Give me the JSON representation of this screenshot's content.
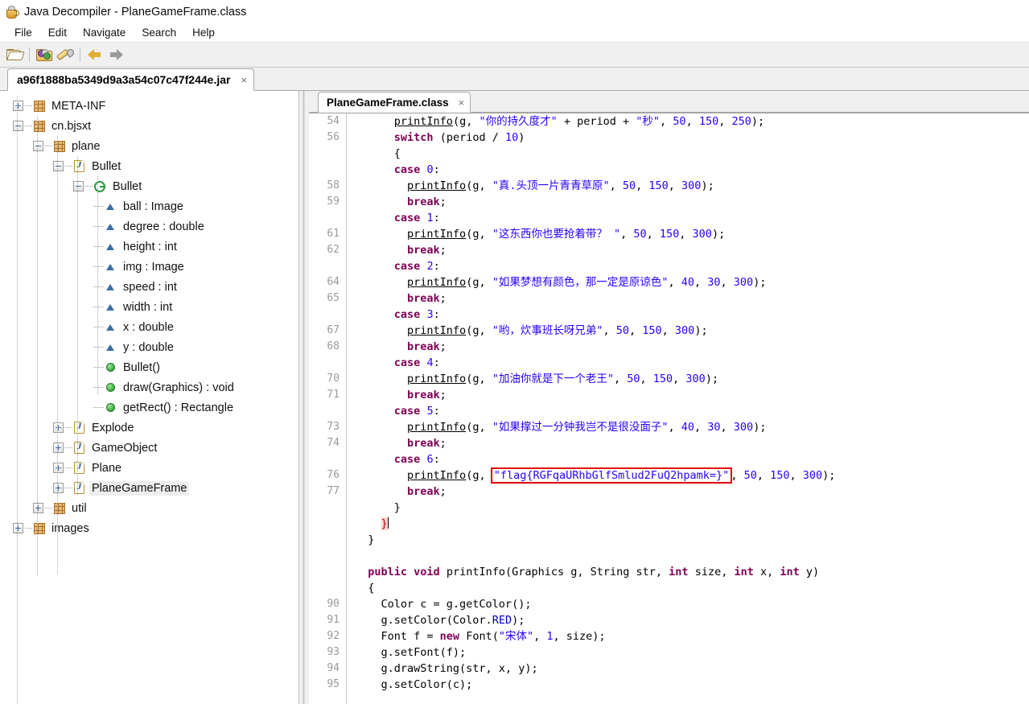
{
  "window": {
    "title": "Java Decompiler - PlaneGameFrame.class",
    "app_icon": "java-coffee-cup-icon"
  },
  "menubar": {
    "items": [
      {
        "label": "File"
      },
      {
        "label": "Edit"
      },
      {
        "label": "Navigate"
      },
      {
        "label": "Search"
      },
      {
        "label": "Help"
      }
    ]
  },
  "toolbar": {
    "buttons": [
      {
        "name": "open-file-button",
        "icon": "folder-open-icon"
      },
      {
        "name": "open-jar-button",
        "icon": "jar-folder-icon"
      },
      {
        "name": "decompile-tool-button",
        "icon": "wand-icon"
      },
      {
        "name": "navigate-back-button",
        "icon": "arrow-left-icon"
      },
      {
        "name": "navigate-forward-button",
        "icon": "arrow-right-icon"
      }
    ]
  },
  "jar_tabs": [
    {
      "label": "a96f1888ba5349d9a3a54c07c47f244e.jar",
      "close": "×",
      "active": true
    }
  ],
  "tree": {
    "nodes": [
      {
        "label": "META-INF",
        "depth": 0,
        "icon": "package-icon",
        "expander": "plus",
        "selected": false
      },
      {
        "label": "cn.bjsxt",
        "depth": 0,
        "icon": "package-icon",
        "expander": "minus",
        "selected": false
      },
      {
        "label": "plane",
        "depth": 1,
        "icon": "package-icon",
        "expander": "minus",
        "selected": false
      },
      {
        "label": "Bullet",
        "depth": 2,
        "icon": "java-file-icon",
        "expander": "minus",
        "selected": false
      },
      {
        "label": "Bullet",
        "depth": 3,
        "icon": "class-icon",
        "expander": "minus",
        "selected": false
      },
      {
        "label": "ball : Image",
        "depth": 4,
        "icon": "field-icon",
        "expander": "none",
        "selected": false
      },
      {
        "label": "degree : double",
        "depth": 4,
        "icon": "field-icon",
        "expander": "none",
        "selected": false
      },
      {
        "label": "height : int",
        "depth": 4,
        "icon": "field-icon",
        "expander": "none",
        "selected": false
      },
      {
        "label": "img : Image",
        "depth": 4,
        "icon": "field-icon",
        "expander": "none",
        "selected": false
      },
      {
        "label": "speed : int",
        "depth": 4,
        "icon": "field-icon",
        "expander": "none",
        "selected": false
      },
      {
        "label": "width : int",
        "depth": 4,
        "icon": "field-icon",
        "expander": "none",
        "selected": false
      },
      {
        "label": "x : double",
        "depth": 4,
        "icon": "field-icon",
        "expander": "none",
        "selected": false
      },
      {
        "label": "y : double",
        "depth": 4,
        "icon": "field-icon",
        "expander": "none",
        "selected": false
      },
      {
        "label": "Bullet()",
        "depth": 4,
        "icon": "method-icon",
        "expander": "none",
        "selected": false
      },
      {
        "label": "draw(Graphics) : void",
        "depth": 4,
        "icon": "method-icon",
        "expander": "none",
        "selected": false
      },
      {
        "label": "getRect() : Rectangle",
        "depth": 4,
        "icon": "method-icon",
        "expander": "none",
        "selected": false
      },
      {
        "label": "Explode",
        "depth": 2,
        "icon": "java-file-icon",
        "expander": "plus",
        "selected": false
      },
      {
        "label": "GameObject",
        "depth": 2,
        "icon": "java-file-icon",
        "expander": "plus",
        "selected": false
      },
      {
        "label": "Plane",
        "depth": 2,
        "icon": "java-file-icon",
        "expander": "plus",
        "selected": false
      },
      {
        "label": "PlaneGameFrame",
        "depth": 2,
        "icon": "java-file-icon",
        "expander": "plus",
        "selected": true
      },
      {
        "label": "util",
        "depth": 1,
        "icon": "package-icon",
        "expander": "plus",
        "selected": false
      },
      {
        "label": "images",
        "depth": 0,
        "icon": "package-icon",
        "expander": "plus",
        "selected": false
      }
    ]
  },
  "editor": {
    "tabs": [
      {
        "label": "PlaneGameFrame.class",
        "close": "×",
        "active": true
      }
    ],
    "gutter": [
      "54",
      "56",
      "",
      "",
      "58",
      "59",
      "",
      "61",
      "62",
      "",
      "64",
      "65",
      "",
      "67",
      "68",
      "",
      "70",
      "71",
      "",
      "73",
      "74",
      "",
      "76",
      "77",
      "",
      "",
      "",
      "",
      "",
      "",
      "90",
      "91",
      "92",
      "93",
      "94",
      "95"
    ],
    "highlight_box_color": "#e00000",
    "flag_string": "\"flag{RGFqaURhbGlfSmlud2FuQ2hpamk=}\"",
    "lines": [
      [
        {
          "t": "      ",
          "c": "plain"
        },
        {
          "t": "printInfo",
          "c": "mth"
        },
        {
          "t": "(g, ",
          "c": "plain"
        },
        {
          "t": "\"你的持久度才\"",
          "c": "str"
        },
        {
          "t": " + period + ",
          "c": "plain"
        },
        {
          "t": "\"秒\"",
          "c": "str"
        },
        {
          "t": ", ",
          "c": "plain"
        },
        {
          "t": "50",
          "c": "num"
        },
        {
          "t": ", ",
          "c": "plain"
        },
        {
          "t": "150",
          "c": "num"
        },
        {
          "t": ", ",
          "c": "plain"
        },
        {
          "t": "250",
          "c": "num"
        },
        {
          "t": ");",
          "c": "plain"
        }
      ],
      [
        {
          "t": "      ",
          "c": "plain"
        },
        {
          "t": "switch",
          "c": "kw"
        },
        {
          "t": " (period / ",
          "c": "plain"
        },
        {
          "t": "10",
          "c": "num"
        },
        {
          "t": ")",
          "c": "plain"
        }
      ],
      [
        {
          "t": "      {",
          "c": "plain"
        }
      ],
      [
        {
          "t": "      ",
          "c": "plain"
        },
        {
          "t": "case",
          "c": "kw"
        },
        {
          "t": " ",
          "c": "plain"
        },
        {
          "t": "0",
          "c": "num"
        },
        {
          "t": ":",
          "c": "plain"
        }
      ],
      [
        {
          "t": "        ",
          "c": "plain"
        },
        {
          "t": "printInfo",
          "c": "mth"
        },
        {
          "t": "(g, ",
          "c": "plain"
        },
        {
          "t": "\"真.头顶一片青青草原\"",
          "c": "str"
        },
        {
          "t": ", ",
          "c": "plain"
        },
        {
          "t": "50",
          "c": "num"
        },
        {
          "t": ", ",
          "c": "plain"
        },
        {
          "t": "150",
          "c": "num"
        },
        {
          "t": ", ",
          "c": "plain"
        },
        {
          "t": "300",
          "c": "num"
        },
        {
          "t": ");",
          "c": "plain"
        }
      ],
      [
        {
          "t": "        ",
          "c": "plain"
        },
        {
          "t": "break",
          "c": "kw"
        },
        {
          "t": ";",
          "c": "plain"
        }
      ],
      [
        {
          "t": "      ",
          "c": "plain"
        },
        {
          "t": "case",
          "c": "kw"
        },
        {
          "t": " ",
          "c": "plain"
        },
        {
          "t": "1",
          "c": "num"
        },
        {
          "t": ":",
          "c": "plain"
        }
      ],
      [
        {
          "t": "        ",
          "c": "plain"
        },
        {
          "t": "printInfo",
          "c": "mth"
        },
        {
          "t": "(g, ",
          "c": "plain"
        },
        {
          "t": "\"这东西你也要抢着带？ \"",
          "c": "str"
        },
        {
          "t": ", ",
          "c": "plain"
        },
        {
          "t": "50",
          "c": "num"
        },
        {
          "t": ", ",
          "c": "plain"
        },
        {
          "t": "150",
          "c": "num"
        },
        {
          "t": ", ",
          "c": "plain"
        },
        {
          "t": "300",
          "c": "num"
        },
        {
          "t": ");",
          "c": "plain"
        }
      ],
      [
        {
          "t": "        ",
          "c": "plain"
        },
        {
          "t": "break",
          "c": "kw"
        },
        {
          "t": ";",
          "c": "plain"
        }
      ],
      [
        {
          "t": "      ",
          "c": "plain"
        },
        {
          "t": "case",
          "c": "kw"
        },
        {
          "t": " ",
          "c": "plain"
        },
        {
          "t": "2",
          "c": "num"
        },
        {
          "t": ":",
          "c": "plain"
        }
      ],
      [
        {
          "t": "        ",
          "c": "plain"
        },
        {
          "t": "printInfo",
          "c": "mth"
        },
        {
          "t": "(g, ",
          "c": "plain"
        },
        {
          "t": "\"如果梦想有颜色，那一定是原谅色\"",
          "c": "str"
        },
        {
          "t": ", ",
          "c": "plain"
        },
        {
          "t": "40",
          "c": "num"
        },
        {
          "t": ", ",
          "c": "plain"
        },
        {
          "t": "30",
          "c": "num"
        },
        {
          "t": ", ",
          "c": "plain"
        },
        {
          "t": "300",
          "c": "num"
        },
        {
          "t": ");",
          "c": "plain"
        }
      ],
      [
        {
          "t": "        ",
          "c": "plain"
        },
        {
          "t": "break",
          "c": "kw"
        },
        {
          "t": ";",
          "c": "plain"
        }
      ],
      [
        {
          "t": "      ",
          "c": "plain"
        },
        {
          "t": "case",
          "c": "kw"
        },
        {
          "t": " ",
          "c": "plain"
        },
        {
          "t": "3",
          "c": "num"
        },
        {
          "t": ":",
          "c": "plain"
        }
      ],
      [
        {
          "t": "        ",
          "c": "plain"
        },
        {
          "t": "printInfo",
          "c": "mth"
        },
        {
          "t": "(g, ",
          "c": "plain"
        },
        {
          "t": "\"哟，炊事班长呀兄弟\"",
          "c": "str"
        },
        {
          "t": ", ",
          "c": "plain"
        },
        {
          "t": "50",
          "c": "num"
        },
        {
          "t": ", ",
          "c": "plain"
        },
        {
          "t": "150",
          "c": "num"
        },
        {
          "t": ", ",
          "c": "plain"
        },
        {
          "t": "300",
          "c": "num"
        },
        {
          "t": ");",
          "c": "plain"
        }
      ],
      [
        {
          "t": "        ",
          "c": "plain"
        },
        {
          "t": "break",
          "c": "kw"
        },
        {
          "t": ";",
          "c": "plain"
        }
      ],
      [
        {
          "t": "      ",
          "c": "plain"
        },
        {
          "t": "case",
          "c": "kw"
        },
        {
          "t": " ",
          "c": "plain"
        },
        {
          "t": "4",
          "c": "num"
        },
        {
          "t": ":",
          "c": "plain"
        }
      ],
      [
        {
          "t": "        ",
          "c": "plain"
        },
        {
          "t": "printInfo",
          "c": "mth"
        },
        {
          "t": "(g, ",
          "c": "plain"
        },
        {
          "t": "\"加油你就是下一个老王\"",
          "c": "str"
        },
        {
          "t": ", ",
          "c": "plain"
        },
        {
          "t": "50",
          "c": "num"
        },
        {
          "t": ", ",
          "c": "plain"
        },
        {
          "t": "150",
          "c": "num"
        },
        {
          "t": ", ",
          "c": "plain"
        },
        {
          "t": "300",
          "c": "num"
        },
        {
          "t": ");",
          "c": "plain"
        }
      ],
      [
        {
          "t": "        ",
          "c": "plain"
        },
        {
          "t": "break",
          "c": "kw"
        },
        {
          "t": ";",
          "c": "plain"
        }
      ],
      [
        {
          "t": "      ",
          "c": "plain"
        },
        {
          "t": "case",
          "c": "kw"
        },
        {
          "t": " ",
          "c": "plain"
        },
        {
          "t": "5",
          "c": "num"
        },
        {
          "t": ":",
          "c": "plain"
        }
      ],
      [
        {
          "t": "        ",
          "c": "plain"
        },
        {
          "t": "printInfo",
          "c": "mth"
        },
        {
          "t": "(g, ",
          "c": "plain"
        },
        {
          "t": "\"如果撑过一分钟我岂不是很没面子\"",
          "c": "str"
        },
        {
          "t": ", ",
          "c": "plain"
        },
        {
          "t": "40",
          "c": "num"
        },
        {
          "t": ", ",
          "c": "plain"
        },
        {
          "t": "30",
          "c": "num"
        },
        {
          "t": ", ",
          "c": "plain"
        },
        {
          "t": "300",
          "c": "num"
        },
        {
          "t": ");",
          "c": "plain"
        }
      ],
      [
        {
          "t": "        ",
          "c": "plain"
        },
        {
          "t": "break",
          "c": "kw"
        },
        {
          "t": ";",
          "c": "plain"
        }
      ],
      [
        {
          "t": "      ",
          "c": "plain"
        },
        {
          "t": "case",
          "c": "kw"
        },
        {
          "t": " ",
          "c": "plain"
        },
        {
          "t": "6",
          "c": "num"
        },
        {
          "t": ":",
          "c": "plain"
        }
      ],
      [
        {
          "t": "        ",
          "c": "plain"
        },
        {
          "t": "printInfo",
          "c": "mth"
        },
        {
          "t": "(g, ",
          "c": "plain"
        },
        {
          "t": "\"flag{RGFqaURhbGlfSmlud2FuQ2hpamk=}\"",
          "c": "str",
          "box": true
        },
        {
          "t": ", ",
          "c": "plain"
        },
        {
          "t": "50",
          "c": "num"
        },
        {
          "t": ", ",
          "c": "plain"
        },
        {
          "t": "150",
          "c": "num"
        },
        {
          "t": ", ",
          "c": "plain"
        },
        {
          "t": "300",
          "c": "num"
        },
        {
          "t": ");",
          "c": "plain"
        }
      ],
      [
        {
          "t": "        ",
          "c": "plain"
        },
        {
          "t": "break",
          "c": "kw"
        },
        {
          "t": ";",
          "c": "plain"
        }
      ],
      [
        {
          "t": "      }",
          "c": "plain"
        }
      ],
      [
        {
          "t": "    ",
          "c": "plain"
        },
        {
          "t": "}",
          "c": "hl-brace"
        },
        {
          "t": "|",
          "c": "caret"
        }
      ],
      [
        {
          "t": "  }",
          "c": "plain"
        }
      ],
      [
        {
          "t": "",
          "c": "plain"
        }
      ],
      [
        {
          "t": "  ",
          "c": "plain"
        },
        {
          "t": "public void",
          "c": "kw"
        },
        {
          "t": " ",
          "c": "plain"
        },
        {
          "t": "printInfo",
          "c": "plain"
        },
        {
          "t": "(Graphics g, String str, ",
          "c": "plain"
        },
        {
          "t": "int",
          "c": "kw"
        },
        {
          "t": " size, ",
          "c": "plain"
        },
        {
          "t": "int",
          "c": "kw"
        },
        {
          "t": " x, ",
          "c": "plain"
        },
        {
          "t": "int",
          "c": "kw"
        },
        {
          "t": " y)",
          "c": "plain"
        }
      ],
      [
        {
          "t": "  {",
          "c": "plain"
        }
      ],
      [
        {
          "t": "    Color c = g.getColor();",
          "c": "plain"
        }
      ],
      [
        {
          "t": "    g.setColor(Color.",
          "c": "plain"
        },
        {
          "t": "RED",
          "c": "fld"
        },
        {
          "t": ");",
          "c": "plain"
        }
      ],
      [
        {
          "t": "    Font f = ",
          "c": "plain"
        },
        {
          "t": "new",
          "c": "kw"
        },
        {
          "t": " Font(",
          "c": "plain"
        },
        {
          "t": "\"宋体\"",
          "c": "str"
        },
        {
          "t": ", ",
          "c": "plain"
        },
        {
          "t": "1",
          "c": "num"
        },
        {
          "t": ", size);",
          "c": "plain"
        }
      ],
      [
        {
          "t": "    g.setFont(f);",
          "c": "plain"
        }
      ],
      [
        {
          "t": "    g.drawString(str, x, y);",
          "c": "plain"
        }
      ],
      [
        {
          "t": "    g.setColor(c);",
          "c": "plain"
        }
      ]
    ]
  }
}
